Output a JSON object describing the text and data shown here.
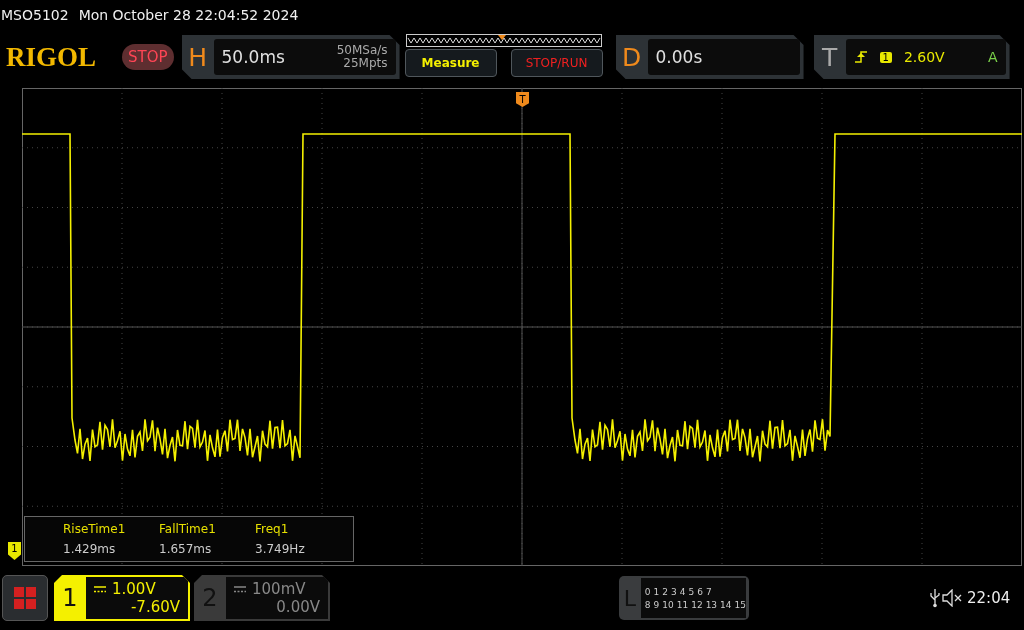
{
  "status_line": {
    "model": "MSO5102",
    "datetime": "Mon October 28 22:04:52 2024"
  },
  "brand": "RIGOL",
  "run_state": "STOP",
  "horizontal": {
    "letter": "H",
    "timebase": "50.0ms",
    "sample_rate": "50MSa/s",
    "memory_depth": "25Mpts"
  },
  "buttons": [
    {
      "label": "Measure",
      "kind": "measure"
    },
    {
      "label": "STOP/RUN",
      "kind": "stoprun"
    }
  ],
  "delay": {
    "letter": "D",
    "value": "0.00s"
  },
  "trigger": {
    "letter": "T",
    "source": "1",
    "level": "2.60V",
    "mode": "A"
  },
  "trigger_marker": "T",
  "channel_marker": "1",
  "measurements": [
    {
      "name": "RiseTime1",
      "value": "1.429ms"
    },
    {
      "name": "FallTime1",
      "value": "1.657ms"
    },
    {
      "name": "Freq1",
      "value": "3.749Hz"
    }
  ],
  "channels": [
    {
      "number": "1",
      "scale": "1.00V",
      "offset": "-7.60V",
      "selected": true
    },
    {
      "number": "2",
      "scale": "100mV",
      "offset": "0.00V",
      "selected": false
    }
  ],
  "logic": {
    "letter": "L",
    "row_1": [
      "0",
      "1",
      "2",
      "3",
      "4",
      "5",
      "6",
      "7"
    ],
    "row_2": [
      "8",
      "9",
      "10",
      "11",
      "12",
      "13",
      "14",
      "15"
    ]
  },
  "clock": "22:04"
}
